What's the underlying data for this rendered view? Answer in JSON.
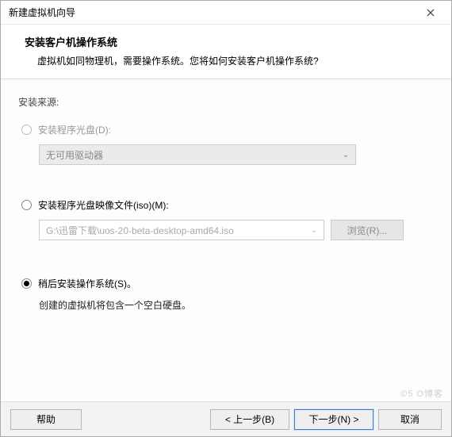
{
  "window": {
    "title": "新建虚拟机向导"
  },
  "header": {
    "title": "安装客户机操作系统",
    "desc": "虚拟机如同物理机，需要操作系统。您将如何安装客户机操作系统?"
  },
  "source_label": "安装来源:",
  "option_disc": {
    "label": "安装程序光盘(D):",
    "combo_text": "无可用驱动器"
  },
  "option_iso": {
    "label": "安装程序光盘映像文件(iso)(M):",
    "path": "G:\\迅雷下载\\uos-20-beta-desktop-amd64.iso",
    "browse": "浏览(R)..."
  },
  "option_later": {
    "label": "稍后安装操作系统(S)。",
    "desc": "创建的虚拟机将包含一个空白硬盘。"
  },
  "footer": {
    "help": "帮助",
    "back": "< 上一步(B)",
    "next": "下一步(N) >",
    "cancel": "取消"
  },
  "watermark": "©5      O博客"
}
